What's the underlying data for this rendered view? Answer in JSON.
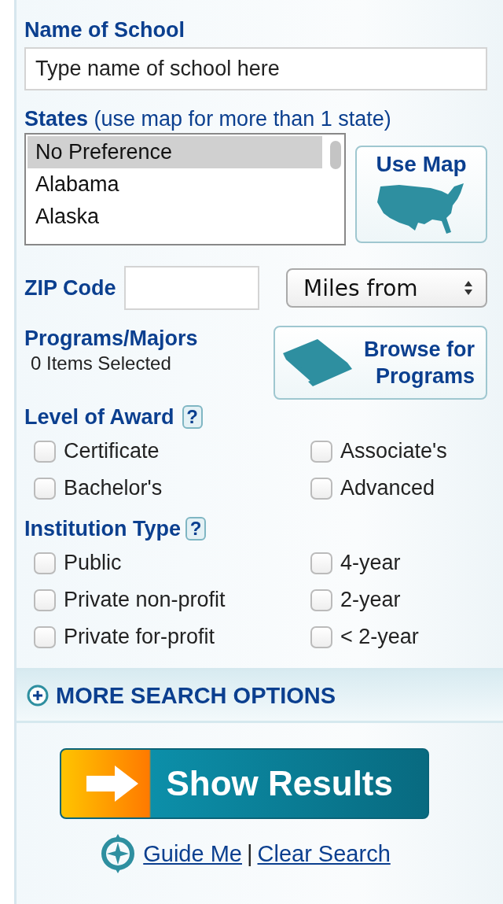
{
  "school_name": {
    "label": "Name of School",
    "placeholder": "Type name of school here"
  },
  "states": {
    "label": "States",
    "hint": "(use map for more than 1 state)",
    "options": [
      {
        "label": "No Preference",
        "selected": true
      },
      {
        "label": "Alabama",
        "selected": false
      },
      {
        "label": "Alaska",
        "selected": false
      }
    ],
    "map_button": "Use Map"
  },
  "zip": {
    "label": "ZIP Code",
    "distance_select": "Miles from"
  },
  "programs": {
    "label": "Programs/Majors",
    "count": "0 Items Selected",
    "browse_button": "Browse for Programs"
  },
  "level_of_award": {
    "title": "Level of Award",
    "help": "?",
    "options": [
      {
        "label": "Certificate",
        "checked": false
      },
      {
        "label": "Associate's",
        "checked": false
      },
      {
        "label": "Bachelor's",
        "checked": false
      },
      {
        "label": "Advanced",
        "checked": false
      }
    ]
  },
  "institution_type": {
    "title": "Institution Type",
    "help": "?",
    "options": [
      {
        "label": "Public",
        "checked": false
      },
      {
        "label": "4-year",
        "checked": false
      },
      {
        "label": "Private non-profit",
        "checked": false
      },
      {
        "label": "2-year",
        "checked": false
      },
      {
        "label": "Private for-profit",
        "checked": false
      },
      {
        "label": "< 2-year",
        "checked": false
      }
    ]
  },
  "more_options": "MORE SEARCH OPTIONS",
  "show_results_button": "Show Results",
  "links": [
    {
      "label": "Guide Me"
    },
    {
      "label": "Clear Search"
    }
  ],
  "link_separator": "|"
}
